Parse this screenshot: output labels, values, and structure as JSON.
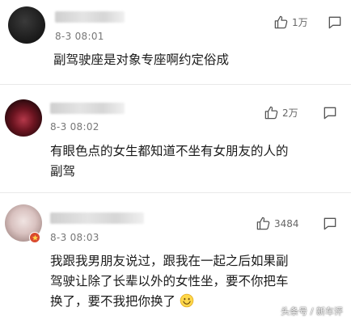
{
  "comments": [
    {
      "time": "8-3 08:01",
      "likes": "1万",
      "text": "副驾驶座是对象专座啊约定俗成"
    },
    {
      "time": "8-3 08:02",
      "likes": "2万",
      "text_line1": "有眼色点的女生都知道不坐有女朋友的人的",
      "text_line2": "副驾"
    },
    {
      "time": "8-3 08:03",
      "likes": "3484",
      "text_line1": "我跟我男朋友说过，跟我在一起之后如果副",
      "text_line2": "驾驶让除了长辈以外的女性坐，要不你把车",
      "text_line3": "换了，要不我把你换了"
    }
  ],
  "icons": {
    "like": "thumbs-up-icon",
    "reply": "reply-icon",
    "emoji": "smile-emoji-icon"
  },
  "watermark": "头条号 / 新车评"
}
